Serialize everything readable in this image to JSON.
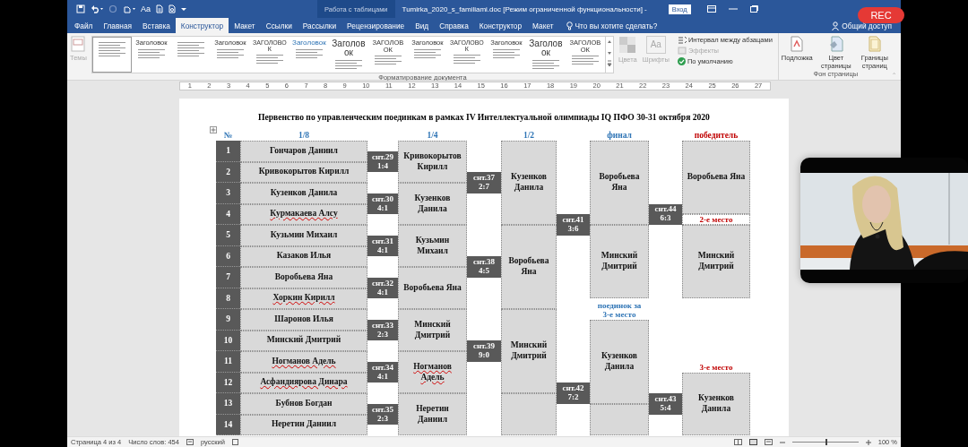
{
  "title_bar": {
    "font_button": "Aa",
    "context_label": "Работа с таблицами",
    "document_title": "Tumirka_2020_s_familiami.doc [Режим ограниченной функциональности]  -",
    "sign_in": "Вход"
  },
  "recording": {
    "label": "REC"
  },
  "tabs": [
    {
      "label": "Файл",
      "selected": false
    },
    {
      "label": "Главная",
      "selected": false
    },
    {
      "label": "Вставка",
      "selected": false
    },
    {
      "label": "Конструктор",
      "selected": true
    },
    {
      "label": "Макет",
      "selected": false
    },
    {
      "label": "Ссылки",
      "selected": false
    },
    {
      "label": "Рассылки",
      "selected": false
    },
    {
      "label": "Рецензирование",
      "selected": false
    },
    {
      "label": "Вид",
      "selected": false
    },
    {
      "label": "Справка",
      "selected": false
    },
    {
      "label": "Конструктор",
      "selected": false
    },
    {
      "label": "Макет",
      "selected": false
    }
  ],
  "tell_me": "Что вы хотите сделать?",
  "share": "Общий доступ",
  "ribbon": {
    "themes": {
      "label": "Темы",
      "disabled": true
    },
    "style_gallery": [
      {
        "selected": true
      },
      {
        "heading": "Заголовок",
        "selected": false
      },
      {
        "selected": false
      },
      {
        "heading": "Заголовок",
        "selected": false
      },
      {
        "heading": "ЗАГОЛОВОК",
        "selected": false
      },
      {
        "heading": "Заголовок",
        "selected": false
      },
      {
        "heading": "Заголовок",
        "selected": false
      },
      {
        "heading": "ЗАГОЛОВОК",
        "selected": false
      },
      {
        "heading": "Заголовок",
        "selected": false
      },
      {
        "heading": "ЗАГОЛОВОК",
        "selected": false
      },
      {
        "heading": "Заголовок",
        "selected": false
      },
      {
        "heading": "Заголовок",
        "selected": false
      },
      {
        "heading": "ЗАГОЛОВОК",
        "selected": false
      }
    ],
    "colors": {
      "label": "Цвета",
      "disabled": true
    },
    "fonts": {
      "label": "Шрифты",
      "icon_text": "Aa",
      "disabled": true
    },
    "paragraph_spacing": {
      "label": "Интервал между абзацами",
      "disabled": false
    },
    "effects": {
      "label": "Эффекты",
      "disabled": true
    },
    "set_default": {
      "label": "По умолчанию",
      "disabled": false
    },
    "watermark": {
      "label": "Подложка"
    },
    "page_color": {
      "label": "Цвет страницы"
    },
    "page_borders": {
      "label": "Границы страниц"
    },
    "group_labels": [
      "Форматирование документа",
      "Фон страницы"
    ]
  },
  "ruler": [
    "1",
    "2",
    "3",
    "4",
    "5",
    "6",
    "7",
    "8",
    "9",
    "10",
    "11",
    "12",
    "13",
    "14",
    "15",
    "16",
    "17",
    "18",
    "19",
    "20",
    "21",
    "22",
    "23",
    "24",
    "25",
    "26",
    "27"
  ],
  "document": {
    "title": "Первенство по управленческим поединкам в рамках IV Интеллектуальной олимпиады IQ ПФО 30-31 октября 2020",
    "headers": [
      {
        "label": "№",
        "color": "#2e74b5"
      },
      {
        "label": "1/8",
        "color": "#2e74b5"
      },
      {
        "label": "1/4",
        "color": "#2e74b5"
      },
      {
        "label": "1/2",
        "color": "#2e74b5"
      },
      {
        "label": "финал",
        "color": "#2e74b5"
      },
      {
        "label": "победитель",
        "color": "#c00000"
      }
    ],
    "round_of_16": [
      {
        "number": "1",
        "name": "Гончаров Даниил",
        "misspelled": false
      },
      {
        "number": "2",
        "name": "Кривокорытов Кирилл",
        "misspelled": false
      },
      {
        "number": "3",
        "name": "Кузенков Данила",
        "misspelled": false
      },
      {
        "number": "4",
        "name": "Курмакаева Алсу",
        "misspelled": true
      },
      {
        "number": "5",
        "name": "Кузьмин Михаил",
        "misspelled": false
      },
      {
        "number": "6",
        "name": "Казаков Илья",
        "misspelled": false
      },
      {
        "number": "7",
        "name": "Воробьева Яна",
        "misspelled": false
      },
      {
        "number": "8",
        "name": "Хоркин Кирилл",
        "misspelled": true
      },
      {
        "number": "9",
        "name": "Шаронов Илья",
        "misspelled": false
      },
      {
        "number": "10",
        "name": "Минский Дмитрий",
        "misspelled": false
      },
      {
        "number": "11",
        "name": "Ногманов Адель",
        "misspelled": true
      },
      {
        "number": "12",
        "name": "Асфандиярова Динара",
        "misspelled": true
      },
      {
        "number": "13",
        "name": "Бубнов Богдан",
        "misspelled": false
      },
      {
        "number": "14",
        "name": "Неретин Даниил",
        "misspelled": false
      }
    ],
    "matches_r16": [
      {
        "label": "снт.29",
        "score": "1:4"
      },
      {
        "label": "снт.30",
        "score": "4:1"
      },
      {
        "label": "снт.31",
        "score": "4:1"
      },
      {
        "label": "снт.32",
        "score": "4:1"
      },
      {
        "label": "снт.33",
        "score": "2:3"
      },
      {
        "label": "снт.34",
        "score": "4:1"
      },
      {
        "label": "снт.35",
        "score": "2:3"
      }
    ],
    "quarterfinals": [
      {
        "name": "Кривокорытов Кирилл",
        "misspelled": false
      },
      {
        "name": "Кузенков Данила",
        "misspelled": false
      },
      {
        "name": "Кузьмин Михаил",
        "misspelled": false
      },
      {
        "name": "Воробьева Яна",
        "misspelled": false
      },
      {
        "name": "Минский Дмитрий",
        "misspelled": false
      },
      {
        "name": "Ногманов Адель",
        "misspelled": true
      },
      {
        "name": "Неретин Даниил",
        "misspelled": false
      }
    ],
    "matches_qf": [
      {
        "label": "снт.37",
        "score": "2:7"
      },
      {
        "label": "снт.38",
        "score": "4:5"
      },
      {
        "label": "снт.39",
        "score": "9:0"
      }
    ],
    "semifinals": [
      {
        "name": "Кузенков Данила"
      },
      {
        "name": "Воробьева Яна"
      },
      {
        "name": "Минский Дмитрий"
      }
    ],
    "matches_sf": [
      {
        "label": "снт.41",
        "score": "3:6"
      },
      {
        "label": "снт.42",
        "score": "7:2"
      }
    ],
    "final": [
      {
        "name": "Воробьева Яна"
      },
      {
        "name": "Минский Дмитрий"
      }
    ],
    "third_place_match_label": {
      "text": "поединок за 3-е место",
      "color": "#2e74b5"
    },
    "third_place_match": [
      {
        "name": "Кузенков Данила"
      }
    ],
    "matches_final": [
      {
        "label": "снт.44",
        "score": "6:3"
      },
      {
        "label": "снт.43",
        "score": "5:4"
      }
    ],
    "winner": "Воробьева Яна",
    "second_label": {
      "text": "2-е место",
      "color": "#c00000"
    },
    "second": "Минский Дмитрий",
    "third_label": {
      "text": "3-е место",
      "color": "#c00000"
    },
    "third": "Кузенков Данила"
  },
  "status_bar": {
    "page": "Страница 4 из 4",
    "words": "Число слов: 454",
    "language": "русский",
    "zoom_slider": {
      "level": 0.5
    },
    "zoom": "100 %"
  }
}
